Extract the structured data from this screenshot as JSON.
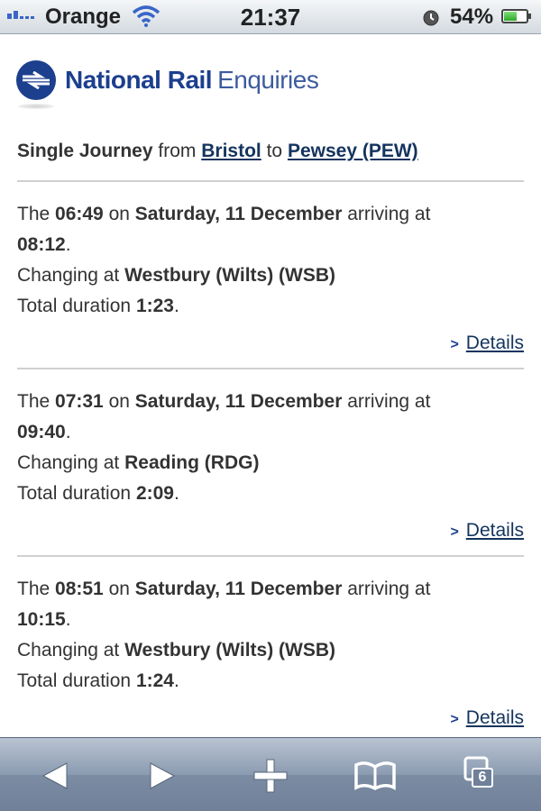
{
  "status_bar": {
    "carrier": "Orange",
    "time": "21:37",
    "battery_percent": "54%",
    "battery_level": 0.54
  },
  "logo": {
    "bold_text": "National Rail",
    "light_text": "Enquiries",
    "brand_color": "#1c3f8e"
  },
  "journey": {
    "type": "Single Journey",
    "from_word": "from",
    "origin": "Bristol",
    "to_word": "to",
    "destination": "Pewsey (PEW)"
  },
  "results": [
    {
      "the": "The",
      "depart": "06:49",
      "on": "on",
      "date": "Saturday, 11 December",
      "arriving_at": "arriving at",
      "arrive": "08:12",
      "changing_at": "Changing at",
      "change_station": "Westbury (Wilts) (WSB)",
      "total_duration": "Total duration",
      "duration": "1:23",
      "details_link": "Details"
    },
    {
      "the": "The",
      "depart": "07:31",
      "on": "on",
      "date": "Saturday, 11 December",
      "arriving_at": "arriving at",
      "arrive": "09:40",
      "changing_at": "Changing at",
      "change_station": "Reading (RDG)",
      "total_duration": "Total duration",
      "duration": "2:09",
      "details_link": "Details"
    },
    {
      "the": "The",
      "depart": "08:51",
      "on": "on",
      "date": "Saturday, 11 December",
      "arriving_at": "arriving at",
      "arrive": "10:15",
      "changing_at": "Changing at",
      "change_station": "Westbury (Wilts) (WSB)",
      "total_duration": "Total duration",
      "duration": "1:24",
      "details_link": "Details"
    }
  ],
  "toolbar": {
    "back_icon": "back-arrow-icon",
    "forward_icon": "forward-arrow-icon",
    "add_icon": "plus-icon",
    "bookmarks_icon": "open-book-icon",
    "tabs_icon": "pages-icon",
    "tab_count": "6"
  }
}
